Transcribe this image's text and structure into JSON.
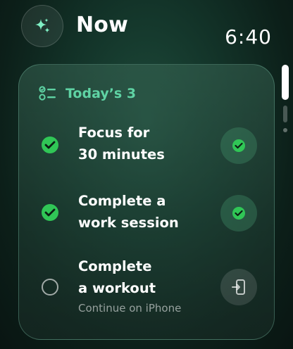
{
  "header": {
    "title": "Now",
    "time": "6:40",
    "icon": "sparkle-icon"
  },
  "card": {
    "title": "Today’s 3",
    "title_icon": "checklist-icon",
    "accent_color": "#5fd3a4",
    "done_color": "#30c656",
    "tasks": [
      {
        "text": "Focus for\n30 minutes",
        "status": "done",
        "action_icon": "check-icon"
      },
      {
        "text": "Complete a\nwork session",
        "status": "done",
        "action_icon": "check-icon"
      },
      {
        "text": "Complete\na workout",
        "status": "open",
        "subtitle": "Continue on iPhone",
        "action_icon": "open-on-phone-icon"
      }
    ]
  }
}
